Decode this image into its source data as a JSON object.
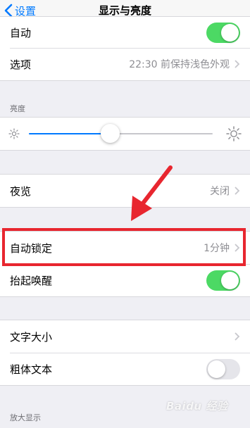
{
  "nav": {
    "back_label": "设置",
    "title": "显示与亮度"
  },
  "group1": {
    "rows": [
      {
        "label": "自动",
        "toggle": "on"
      },
      {
        "label": "选项",
        "value": "22:30 前保持浅色外观"
      }
    ]
  },
  "brightness": {
    "header": "亮度",
    "level": 0.44
  },
  "group2": {
    "night_shift": {
      "label": "夜览",
      "value": "关闭"
    }
  },
  "group3": {
    "auto_lock": {
      "label": "自动锁定",
      "value": "1分钟"
    },
    "raise_to_wake": {
      "label": "抬起唤醒",
      "toggle": "on"
    }
  },
  "group4": {
    "text_size": {
      "label": "文字大小"
    },
    "bold_text": {
      "label": "粗体文本",
      "toggle": "off"
    }
  },
  "zoom_header": "放大显示",
  "watermark": "Baidu 经验",
  "colors": {
    "accent": "#007aff",
    "toggle_on": "#4cd964",
    "highlight": "#e8262f"
  }
}
